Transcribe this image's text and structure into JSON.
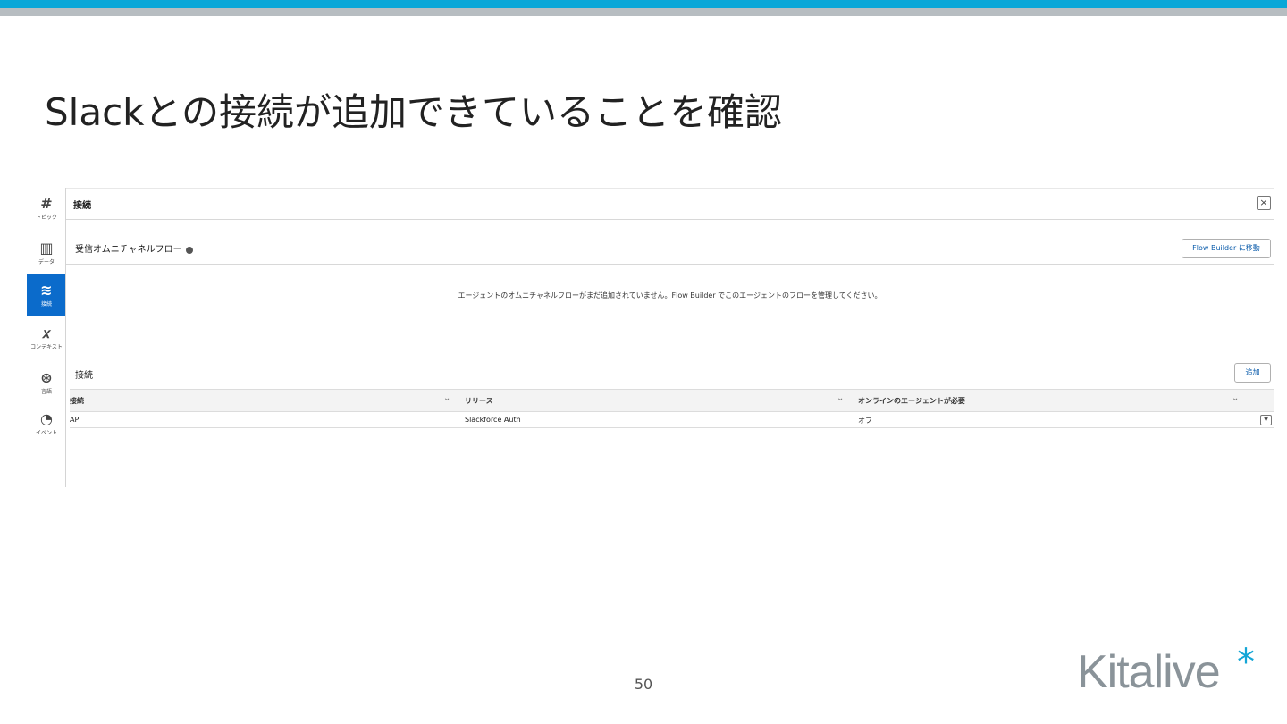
{
  "slide": {
    "title": "Slackとの接続が追加できていることを確認",
    "page_number": "50",
    "logo_text": "Kitalive",
    "logo_mark": "*",
    "colors": {
      "top_bar": "#0aa7d8",
      "accent": "#0b6bcb",
      "logo_star": "#14a6d6"
    }
  },
  "sidebar": {
    "items": [
      {
        "icon": "hash-icon",
        "glyph": "#",
        "label": "トピック"
      },
      {
        "icon": "book-icon",
        "glyph": "▥",
        "label": "データ"
      },
      {
        "icon": "layers-icon",
        "glyph": "≋",
        "label": "接続",
        "active": true
      },
      {
        "icon": "variable-icon",
        "glyph": "𝑥",
        "label": "コンテキスト"
      },
      {
        "icon": "palette-icon",
        "glyph": "⊛",
        "label": "言語"
      },
      {
        "icon": "event-icon",
        "glyph": "◔",
        "label": "イベント"
      }
    ]
  },
  "panel": {
    "header_title": "接続",
    "close_label": "×",
    "omni_section_title": "受信オムニチャネルフロー",
    "info_glyph": "i",
    "flow_builder_button": "Flow Builder に移動",
    "empty_message": "エージェントのオムニチャネルフローがまだ追加されていません。Flow Builder でこのエージェントのフローを管理してください。",
    "connections_section_title": "接続",
    "add_button": "追加",
    "table": {
      "columns": [
        "接続",
        "リリース",
        "オンラインのエージェントが必要"
      ],
      "rows": [
        [
          "API",
          "Slackforce Auth",
          "オフ"
        ]
      ]
    }
  }
}
